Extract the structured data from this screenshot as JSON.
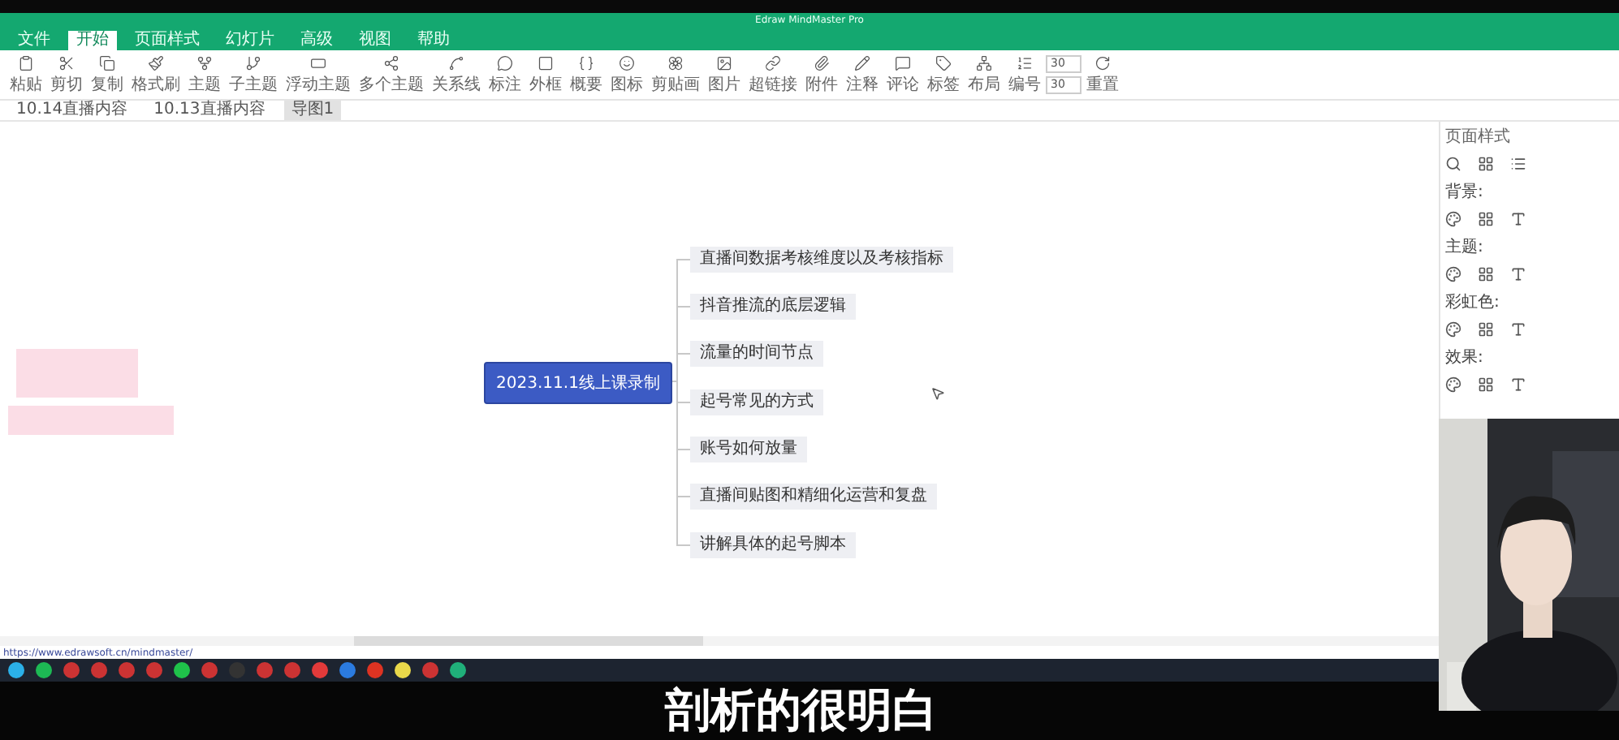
{
  "window": {
    "title": "Edraw MindMaster Pro"
  },
  "menu": [
    {
      "label": "文件",
      "selected": false
    },
    {
      "label": "开始",
      "selected": true
    },
    {
      "label": "页面样式",
      "selected": false
    },
    {
      "label": "幻灯片",
      "selected": false
    },
    {
      "label": "高级",
      "selected": false
    },
    {
      "label": "视图",
      "selected": false
    },
    {
      "label": "帮助",
      "selected": false
    }
  ],
  "toolbar": [
    {
      "label": "粘贴"
    },
    {
      "label": "剪切"
    },
    {
      "label": "复制"
    },
    {
      "label": "格式刷"
    },
    {
      "label": "主题"
    },
    {
      "label": "子主题"
    },
    {
      "label": "浮动主题"
    },
    {
      "label": "多个主题"
    },
    {
      "label": "关系线"
    },
    {
      "label": "标注"
    },
    {
      "label": "外框"
    },
    {
      "label": "概要"
    },
    {
      "label": "图标"
    },
    {
      "label": "剪贴画"
    },
    {
      "label": "图片"
    },
    {
      "label": "超链接"
    },
    {
      "label": "附件"
    },
    {
      "label": "注释"
    },
    {
      "label": "评论"
    },
    {
      "label": "标签"
    },
    {
      "label": "布局"
    },
    {
      "label": "编号"
    }
  ],
  "spinners": [
    "30",
    "30"
  ],
  "reset": {
    "label": "重置"
  },
  "doc_tabs": [
    {
      "label": "10.14直播内容",
      "selected": false
    },
    {
      "label": "10.13直播内容",
      "selected": false
    },
    {
      "label": "导图1",
      "selected": true
    }
  ],
  "mindmap": {
    "root": "2023.11.1线上课录制",
    "topics": [
      "直播间数据考核维度以及考核指标",
      "抖音推流的底层逻辑",
      "流量的时间节点",
      "起号常见的方式",
      "账号如何放量",
      "直播间贴图和精细化运营和复盘",
      "讲解具体的起号脚本"
    ]
  },
  "side_panel": {
    "title": "页面样式",
    "sections": [
      "背景:",
      "主题:",
      "彩虹色:",
      "效果:"
    ]
  },
  "status_url": "https://www.edrawsoft.cn/mindmaster/",
  "subtitle": "剖析的很明白",
  "webcam": {
    "kind": "picture"
  }
}
